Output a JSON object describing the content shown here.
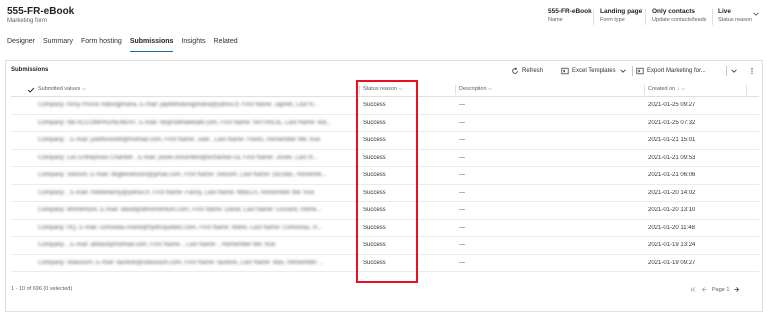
{
  "header": {
    "title": "555-FR-eBook",
    "subtitle": "Marketing form",
    "fields": [
      {
        "value": "555-FR-eBook",
        "label": "Name"
      },
      {
        "value": "Landing page",
        "label": "Form type"
      },
      {
        "value": "Only contacts",
        "label": "Update contacts/leads"
      },
      {
        "value": "Live",
        "label": "Status reason"
      }
    ]
  },
  "tabs": [
    "Designer",
    "Summary",
    "Form hosting",
    "Submissions",
    "Insights",
    "Related"
  ],
  "active_tab": "Submissions",
  "panel": {
    "title": "Submissions",
    "refresh": "Refresh",
    "excel": "Excel Templates",
    "export": "Export Marketing for..."
  },
  "grid": {
    "columns": {
      "submitted": "Submitted values",
      "status": "Status reason",
      "description": "Description",
      "created": "Created on"
    },
    "rows": [
      {
        "values": "Company: Anny Prince Hatungimana, E-mail: japhethatungimana@yahoo.fr, First Name: Japhet, Last N...",
        "status": "Success",
        "description": "---",
        "created": "2021-01-25 09:27"
      },
      {
        "values": "Company: NB ACCOMPAGNEMENT, E-mail: nb@nathalieballi.com, First Name: NATHALIE, Last Name: Bal...",
        "status": "Success",
        "description": "---",
        "created": "2021-01-25 07:32"
      },
      {
        "values": "Company: , E-mail: julieflores89@hotmail.com, First Name: Julie , Last Name: Flores, Remember Me: true",
        "status": "Success",
        "description": "---",
        "created": "2021-01-21 15:01"
      },
      {
        "values": "Company: Les Entreprises Chantier , E-mail: josee.vincenteni@echantier.ca, First Name: Josée, Last N...",
        "status": "Success",
        "description": "---",
        "created": "2021-01-21 09:53"
      },
      {
        "values": "Company: Seloom, E-mail: degbeseloom@gmail.com, First Name: Seloom, Last Name: DEGBE, Rememb...",
        "status": "Success",
        "description": "---",
        "created": "2021-01-21 06:06"
      },
      {
        "values": "Company: , E-mail: mbelefanny@yahoo.fr, First Name: Fanny, Last Name: MBELA, Remember Me: true",
        "status": "Success",
        "description": "---",
        "created": "2021-01-20 14:02"
      },
      {
        "values": "Company: Momentum, E-mail: david@dlmomentum.com, First Name: David, Last Name: Lessard, Reme...",
        "status": "Success",
        "description": "---",
        "created": "2021-01-20 13:10"
      },
      {
        "values": "Company: HQ, E-mail: comiveau.marie@hydroquebec.com, First Name: Marie, Last Name: Comiveau, R...",
        "status": "Success",
        "description": "---",
        "created": "2021-01-20 11:48"
      },
      {
        "values": "Company: , E-mail: ablasd@hotmail.com, First Name: , Last Name: , Remember Me: true",
        "status": "Success",
        "description": "---",
        "created": "2021-01-19 13:24"
      },
      {
        "values": "Company: vdavioum, E-mail: laurene@vdavioum.com, First Name: laurene, Last Name: dias, Remember ...",
        "status": "Success",
        "description": "---",
        "created": "2021-01-19 09:27"
      }
    ]
  },
  "footer": {
    "count": "1 - 10 of 696 (0 selected)",
    "page": "Page 1"
  },
  "colors": {
    "accent": "#0f6cbd",
    "highlight": "#e81123"
  }
}
